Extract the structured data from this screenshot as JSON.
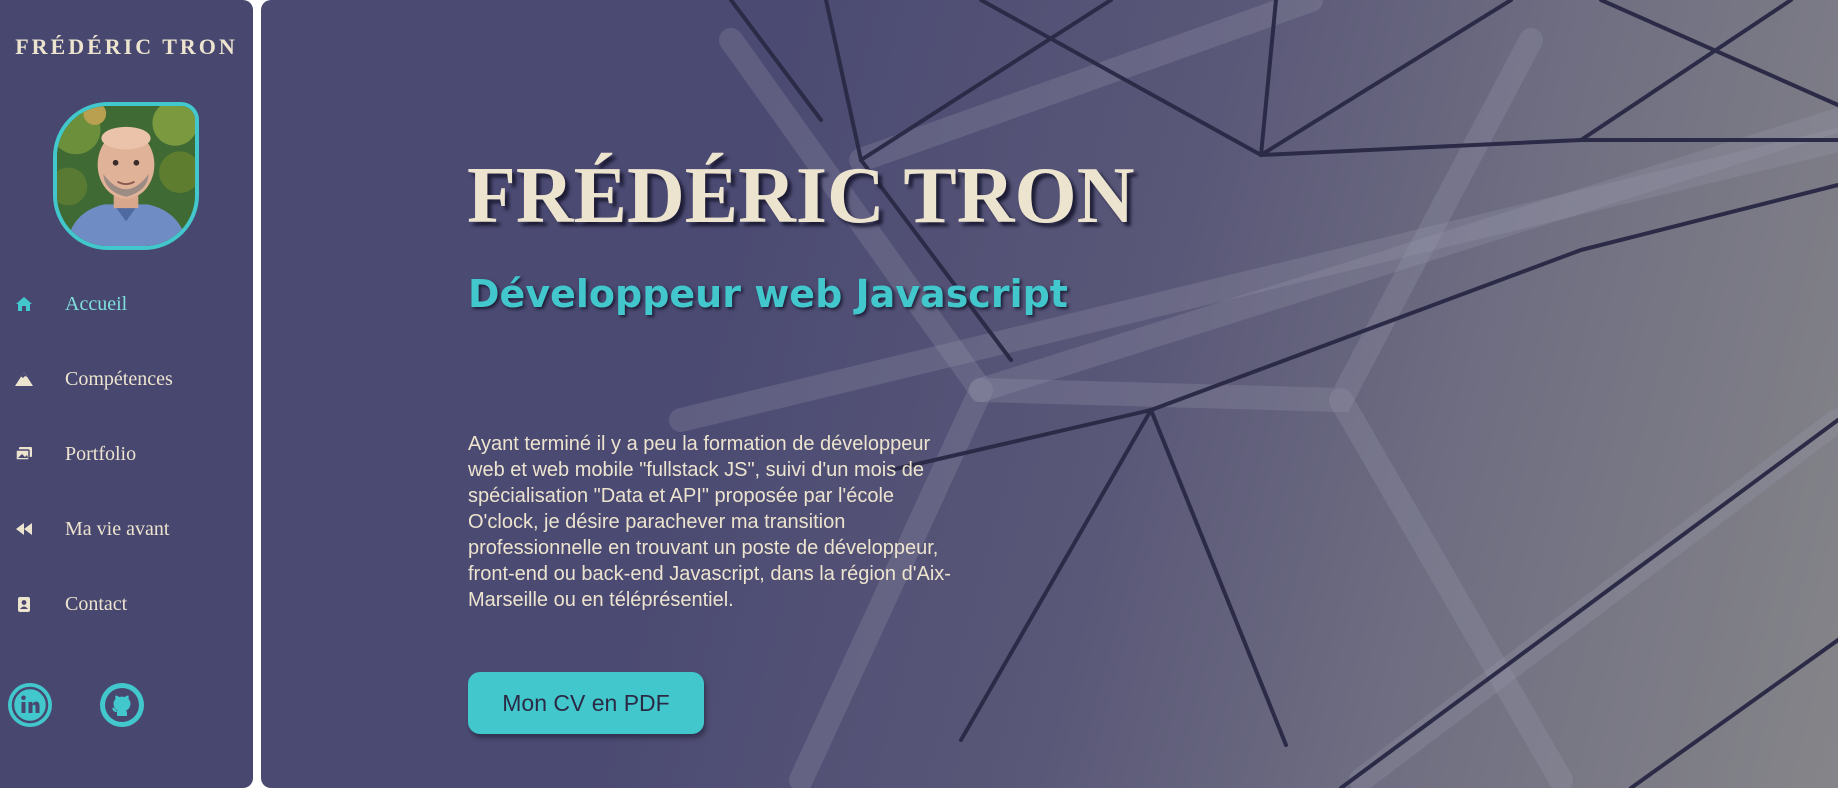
{
  "sidebar": {
    "name": "FRÉDÉRIC TRON",
    "avatar_alt": "Frédéric Tron",
    "nav": [
      {
        "label": "Accueil",
        "icon": "home-icon",
        "active": true
      },
      {
        "label": "Compétences",
        "icon": "mountain-icon",
        "active": false
      },
      {
        "label": "Portfolio",
        "icon": "images-icon",
        "active": false
      },
      {
        "label": "Ma vie avant",
        "icon": "backward-icon",
        "active": false
      },
      {
        "label": "Contact",
        "icon": "address-book-icon",
        "active": false
      }
    ],
    "social": [
      {
        "label": "LinkedIn",
        "icon": "linkedin-icon"
      },
      {
        "label": "GitHub",
        "icon": "github-icon"
      }
    ]
  },
  "hero": {
    "title": "FRÉDÉRIC TRON",
    "subtitle": "Développeur web Javascript",
    "intro": "Ayant terminé il y a peu la formation de développeur web et web mobile \"fullstack JS\", suivi d'un mois de spécialisation \"Data et API\" proposée par l'école O'clock, je désire parachever ma transition professionnelle en trouvant un poste de développeur, front-end ou back-end Javascript, dans la région d'Aix-Marseille ou en téléprésentiel.",
    "cv_button": "Mon CV en PDF"
  },
  "colors": {
    "sidebar_bg": "#484770",
    "accent": "#42c8cc",
    "cream_text": "#ede4cf",
    "active_nav": "#7fe0dc"
  }
}
